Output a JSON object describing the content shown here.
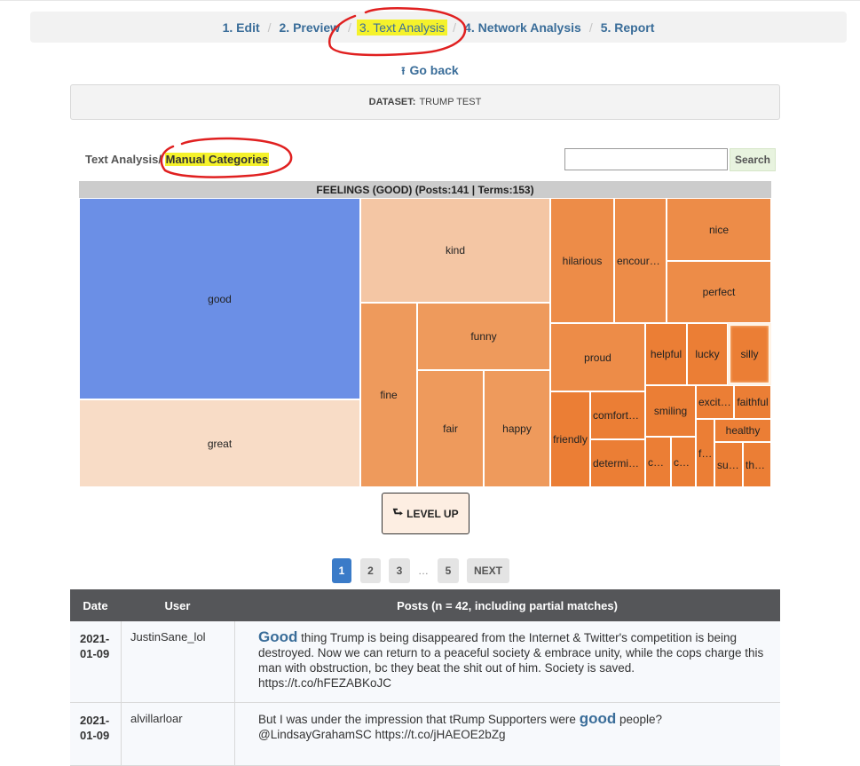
{
  "steps": {
    "edit": "1. Edit",
    "preview": "2. Preview",
    "text_analysis": "3. Text Analysis",
    "network_analysis": "4. Network Analysis",
    "report": "5. Report",
    "separator": "/"
  },
  "go_back": "Go back",
  "dataset": {
    "label": "DATASET:",
    "name": "TRUMP TEST"
  },
  "breadcrumb": {
    "parent": "Text Analysis",
    "current": "Manual Categories",
    "sep": "/"
  },
  "search": {
    "button": "Search",
    "value": ""
  },
  "treemap": {
    "header": "FEELINGS (GOOD) (Posts:141 | Terms:153)",
    "highlight_color": "#f5f22b",
    "cells": [
      {
        "label": "good",
        "color": "#6b8fe6"
      },
      {
        "label": "great",
        "color": "#f8dcc6"
      },
      {
        "label": "kind",
        "color": "#f4c6a4"
      },
      {
        "label": "fine",
        "color": "#ee9a5c"
      },
      {
        "label": "funny",
        "color": "#ee9a5c"
      },
      {
        "label": "fair",
        "color": "#ee9a5c"
      },
      {
        "label": "happy",
        "color": "#ee9a5c"
      },
      {
        "label": "hilarious",
        "color": "#ed8c48"
      },
      {
        "label": "encoura…",
        "color": "#ed8c48"
      },
      {
        "label": "nice",
        "color": "#ed8c48"
      },
      {
        "label": "perfect",
        "color": "#ed8c48"
      },
      {
        "label": "proud",
        "color": "#ed8c48"
      },
      {
        "label": "helpful",
        "color": "#eb7e35"
      },
      {
        "label": "lucky",
        "color": "#eb7e35"
      },
      {
        "label": "silly",
        "color": "#eb7e35"
      },
      {
        "label": "friendly",
        "color": "#eb7e35"
      },
      {
        "label": "comforta…",
        "color": "#eb7e35"
      },
      {
        "label": "smiling",
        "color": "#eb7e35"
      },
      {
        "label": "excited",
        "color": "#eb7e35"
      },
      {
        "label": "faithful",
        "color": "#eb7e35"
      },
      {
        "label": "healthy",
        "color": "#eb7e35"
      },
      {
        "label": "determined",
        "color": "#eb7e35"
      },
      {
        "label": "calm",
        "color": "#eb7e35"
      },
      {
        "label": "co…",
        "color": "#eb7e35"
      },
      {
        "label": "fa…",
        "color": "#eb7e35"
      },
      {
        "label": "suc…",
        "color": "#eb7e35"
      },
      {
        "label": "tho…",
        "color": "#eb7e35"
      }
    ],
    "level_up": "LEVEL UP"
  },
  "pager": {
    "pages": [
      "1",
      "2",
      "3",
      "5"
    ],
    "ellipsis": "…",
    "next": "NEXT",
    "current": "1"
  },
  "table": {
    "headers": {
      "date": "Date",
      "user": "User",
      "posts": "Posts (n = 42, including partial matches)"
    },
    "rows": [
      {
        "date_line1": "2021-",
        "date_line2": "01-09",
        "user": "JustinSane_lol",
        "post_keyword": "Good",
        "post_text": " thing Trump is being disappeared from the Internet & Twitter's competition is being destroyed. Now we can return to a peaceful society & embrace unity, while the cops charge this man with obstruction, bc they beat the shit out of him. Society is saved. https://t.co/hFEZABKoJC"
      },
      {
        "date_line1": "2021-",
        "date_line2": "01-09",
        "user": "alvillarloar",
        "post_before": "But I was under the impression that tRump Supporters were ",
        "post_keyword": "good",
        "post_after": " people? @LindsayGrahamSC https://t.co/jHAEOE2bZg"
      }
    ]
  },
  "colors": {
    "accent": "#3a6d99",
    "annotation": "#e02020",
    "table_header": "#555659"
  }
}
